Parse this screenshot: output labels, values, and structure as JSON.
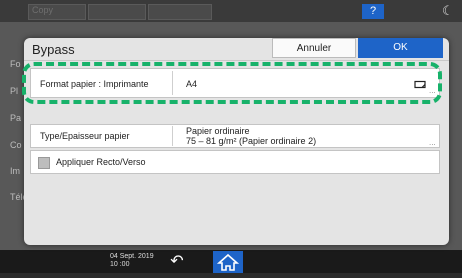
{
  "topbar": {
    "app_title": "Copy",
    "help_label": "?"
  },
  "background": {
    "side_items": [
      "Fo",
      "Pl",
      "Pa",
      "Co",
      "Im",
      "Télé"
    ]
  },
  "bottombar": {
    "date": "04 Sept. 2019",
    "time": "10 :00"
  },
  "dialog": {
    "title": "Bypass",
    "cancel_label": "Annuler",
    "ok_label": "OK",
    "paper_format": {
      "label": "Format papier : Imprimante",
      "value": "A4",
      "more": "..."
    },
    "paper_type": {
      "label": "Type/Epaisseur papier",
      "value_line1": "Papier ordinaire",
      "value_line2": "75 – 81 g/m² (Papier ordinaire 2)",
      "more": "..."
    },
    "duplex": {
      "label": "Appliquer Recto/Verso"
    }
  },
  "colors": {
    "accent": "#1e64c8",
    "highlight": "#17b26a"
  }
}
